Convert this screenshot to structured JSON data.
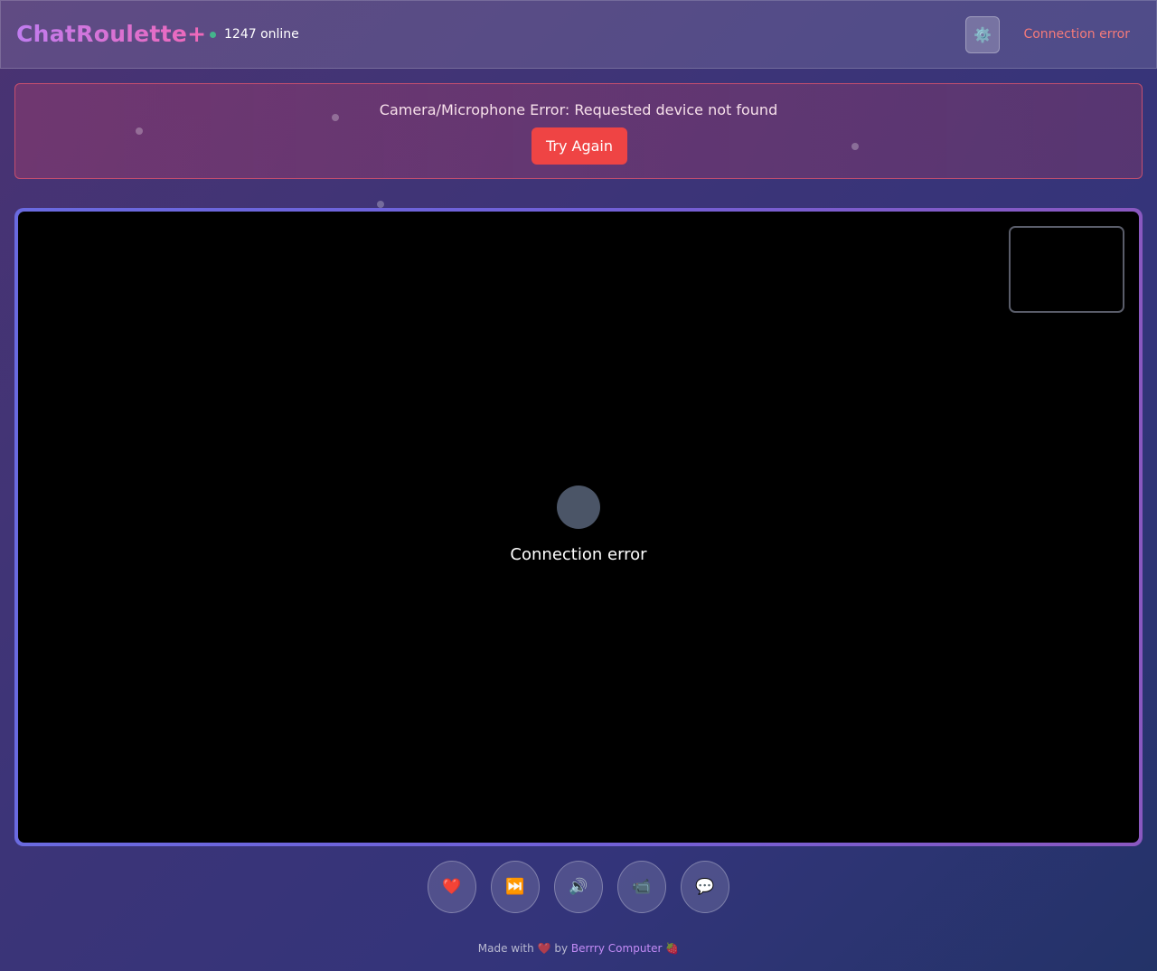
{
  "header": {
    "logo": "ChatRoulette+",
    "online_count": "1247 online",
    "settings_icon": "⚙️",
    "connection_status": "Connection error"
  },
  "error_banner": {
    "message": "Camera/Microphone Error: Requested device not found",
    "retry_label": "Try Again"
  },
  "video": {
    "remote_status": "Connection error"
  },
  "controls": [
    {
      "name": "like",
      "icon": "❤️"
    },
    {
      "name": "skip",
      "icon": "⏭️"
    },
    {
      "name": "audio",
      "icon": "🔊"
    },
    {
      "name": "video",
      "icon": "📹"
    },
    {
      "name": "chat",
      "icon": "💬"
    }
  ],
  "footer": {
    "prefix": "Made with",
    "heart": "❤️",
    "by": "by",
    "brand": "Berrry Computer",
    "brand_icon": "🍓"
  },
  "colors": {
    "accent": "#7060d8",
    "error": "#ef4444",
    "online_dot": "#3ecf8e"
  }
}
